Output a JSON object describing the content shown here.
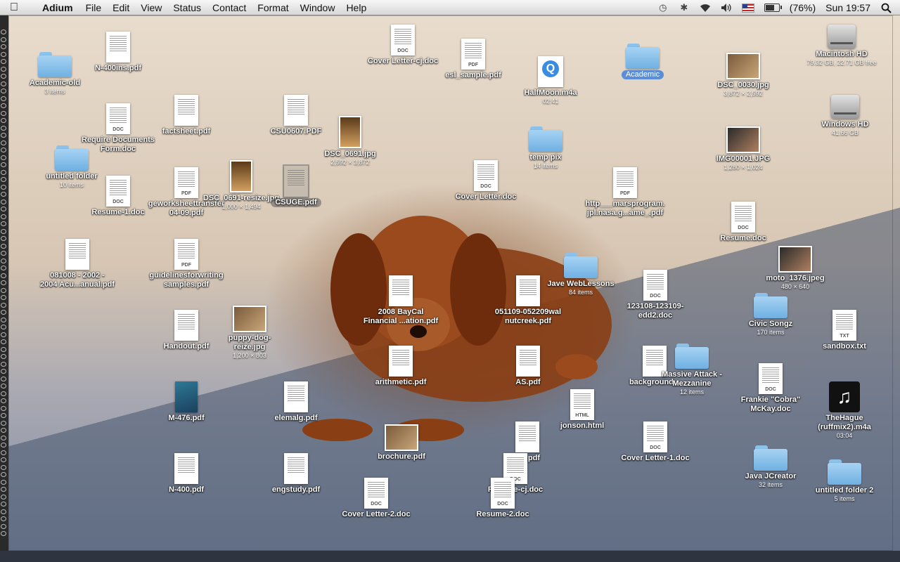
{
  "menubar": {
    "app": "Adium",
    "items": [
      "File",
      "Edit",
      "View",
      "Status",
      "Contact",
      "Format",
      "Window",
      "Help"
    ],
    "battery_percent": "(76%)",
    "battery_level": 0.76,
    "clock": "Sun 19:57"
  },
  "desktop": {
    "icons": [
      {
        "label": "N-400ins.pdf",
        "kind": "doc"
      },
      {
        "label": "Cover Letter-cj.doc",
        "kind": "doc",
        "tag": "DOC"
      },
      {
        "label": "esl_sample.pdf",
        "kind": "doc",
        "tag": "PDF"
      },
      {
        "label": "HalfMoon.m4a",
        "sub": "02:41",
        "kind": "mpeg"
      },
      {
        "label": "Academic",
        "kind": "folder"
      },
      {
        "label": "DSC_0030.jpg",
        "sub": "3,872 × 2,592",
        "kind": "photo"
      },
      {
        "label": "Macintosh HD",
        "sub": "79.32 GB, 22.71 GB free",
        "kind": "hd"
      },
      {
        "label": "Academic-old",
        "sub": "3 items",
        "kind": "folder"
      },
      {
        "label": "factsheet.pdf",
        "kind": "doc"
      },
      {
        "label": "CSU0607.PDF",
        "kind": "doc"
      },
      {
        "label": "DSC_0691.jpg",
        "sub": "2,592 × 3,872",
        "kind": "photo-tall"
      },
      {
        "label": "temp pix",
        "sub": "14 items",
        "kind": "folder"
      },
      {
        "label": "IMG00001.JPG",
        "sub": "1,280 × 1,024",
        "kind": "photo-face"
      },
      {
        "label": "Windows HD",
        "sub": "41.66 GB",
        "kind": "hd"
      },
      {
        "label": "Require Documents\nForm.doc",
        "kind": "doc",
        "tag": "DOC"
      },
      {
        "label": "untitled folder",
        "sub": "10 items",
        "kind": "folder"
      },
      {
        "label": "Resume-1.doc",
        "kind": "doc",
        "tag": "DOC"
      },
      {
        "label": "geworksheettransfer\n04-09.pdf",
        "kind": "doc",
        "tag": "PDF"
      },
      {
        "label": "DSC_0691-resize.jpg",
        "sub": "1,000 × 1,494",
        "kind": "photo-tall"
      },
      {
        "label": "CSUGE.pdf",
        "kind": "doc"
      },
      {
        "label": "Cover Letter.doc",
        "kind": "doc",
        "tag": "DOC"
      },
      {
        "label": "http___marsprogram.\njpl.nasa.g...ame_.pdf",
        "kind": "doc",
        "tag": "PDF"
      },
      {
        "label": "Resume.doc",
        "kind": "doc",
        "tag": "DOC"
      },
      {
        "label": "081008 - 2002 -\n2004 Acu...anual.pdf",
        "kind": "doc"
      },
      {
        "label": "guidelinesforwriting\nsamples.pdf",
        "kind": "doc",
        "tag": "PDF"
      },
      {
        "label": "2008 BayCal\nFinancial ...ation.pdf",
        "kind": "doc"
      },
      {
        "label": "051109-052209wal\nnutcreek.pdf",
        "kind": "doc"
      },
      {
        "label": "Jave WebLessons",
        "sub": "84 items",
        "kind": "folder"
      },
      {
        "label": "123108-123109-\nedd2.doc",
        "kind": "doc",
        "tag": "DOC"
      },
      {
        "label": "moto_1376.jpeg",
        "sub": "480 × 640",
        "kind": "photo-face"
      },
      {
        "label": "Civic Songz",
        "sub": "170 items",
        "kind": "folder"
      },
      {
        "label": "Handout.pdf",
        "kind": "doc"
      },
      {
        "label": "puppy-dog-\nreize.jpg",
        "sub": "1,200 × 803",
        "kind": "photo"
      },
      {
        "label": "sandbox.txt",
        "kind": "doc",
        "tag": "TXT"
      },
      {
        "label": "arithmetic.pdf",
        "kind": "doc"
      },
      {
        "label": "AS.pdf",
        "kind": "doc"
      },
      {
        "label": "background...",
        "kind": "doc"
      },
      {
        "label": "Massive Attack -\nMezzanine",
        "sub": "12 items",
        "kind": "folder"
      },
      {
        "label": "Frankie \"Cobra\"\nMcKay.doc",
        "kind": "doc",
        "tag": "DOC"
      },
      {
        "label": "M-476.pdf",
        "kind": "book"
      },
      {
        "label": "elemalg.pdf",
        "kind": "doc"
      },
      {
        "label": "jonson.html",
        "kind": "doc",
        "tag": "HTML"
      },
      {
        "label": "TheHague\n(ruffmix2).m4a",
        "sub": "03:04",
        "kind": "music"
      },
      {
        "label": "brochure.pdf",
        "kind": "photo"
      },
      {
        "label": "...g.pdf",
        "kind": "doc"
      },
      {
        "label": "Cover Letter-1.doc",
        "kind": "doc",
        "tag": "DOC"
      },
      {
        "label": "N-400.pdf",
        "kind": "doc"
      },
      {
        "label": "engstudy.pdf",
        "kind": "doc"
      },
      {
        "label": "Resume-cj.doc",
        "kind": "doc",
        "tag": "DOC"
      },
      {
        "label": "Java JCreator",
        "sub": "32 items",
        "kind": "folder"
      },
      {
        "label": "untitled folder 2",
        "sub": "5 items",
        "kind": "folder"
      },
      {
        "label": "Cover Letter-2.doc",
        "kind": "doc",
        "tag": "DOC"
      },
      {
        "label": "Resume-2.doc",
        "kind": "doc",
        "tag": "DOC"
      }
    ]
  }
}
